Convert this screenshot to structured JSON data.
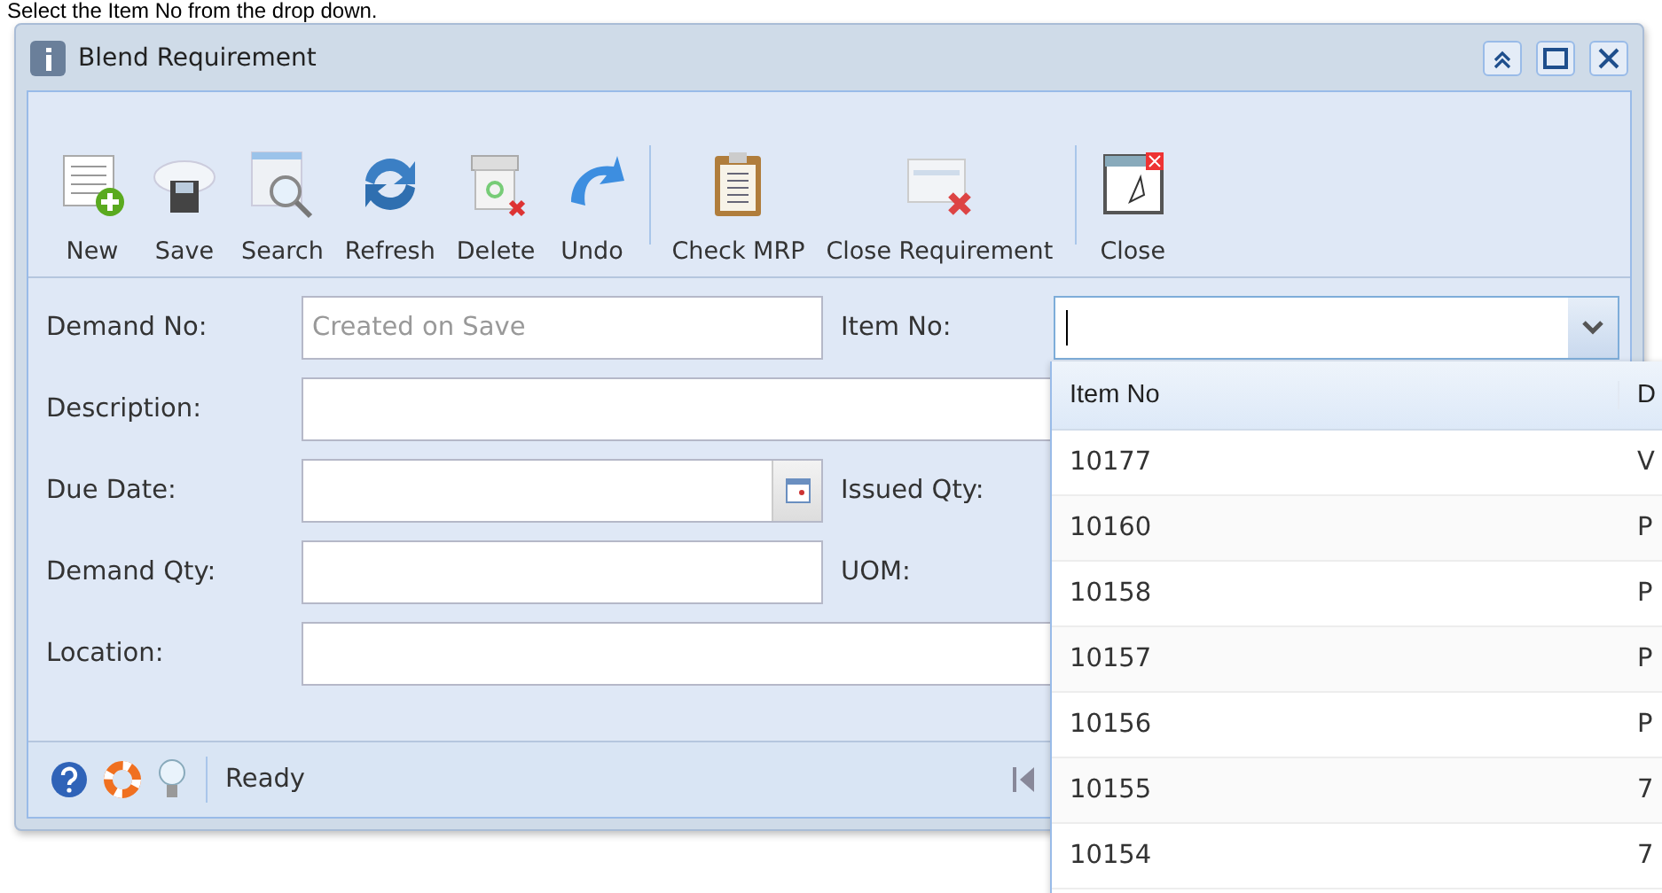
{
  "caption": "Select the Item No from the drop down.",
  "window": {
    "title": "Blend Requirement"
  },
  "toolbar": [
    {
      "label": "New"
    },
    {
      "label": "Save"
    },
    {
      "label": "Search"
    },
    {
      "label": "Refresh"
    },
    {
      "label": "Delete"
    },
    {
      "label": "Undo"
    },
    {
      "label": "Check MRP"
    },
    {
      "label": "Close Requirement"
    },
    {
      "label": "Close"
    }
  ],
  "form": {
    "rows": [
      {
        "label": "Demand No:",
        "placeholder": "Created on Save",
        "kind": "text",
        "right_label": "Item No:"
      },
      {
        "label": "Description:",
        "kind": "wide"
      },
      {
        "label": "Due Date:",
        "kind": "date",
        "right_label": "Issued Qty:"
      },
      {
        "label": "Demand Qty:",
        "kind": "text",
        "right_label": "UOM:"
      },
      {
        "label": "Location:",
        "kind": "wide"
      }
    ]
  },
  "dropdown": {
    "columns": [
      "Item No",
      "D"
    ],
    "rows": [
      {
        "cells": [
          "10177",
          "V"
        ]
      },
      {
        "cells": [
          "10160",
          "P"
        ]
      },
      {
        "cells": [
          "10158",
          "P"
        ]
      },
      {
        "cells": [
          "10157",
          "P"
        ]
      },
      {
        "cells": [
          "10156",
          "P"
        ]
      },
      {
        "cells": [
          "10155",
          "7"
        ]
      },
      {
        "cells": [
          "10154",
          "7"
        ]
      }
    ]
  },
  "status_bar": {
    "text": "Ready",
    "first_page_disabled": true
  }
}
